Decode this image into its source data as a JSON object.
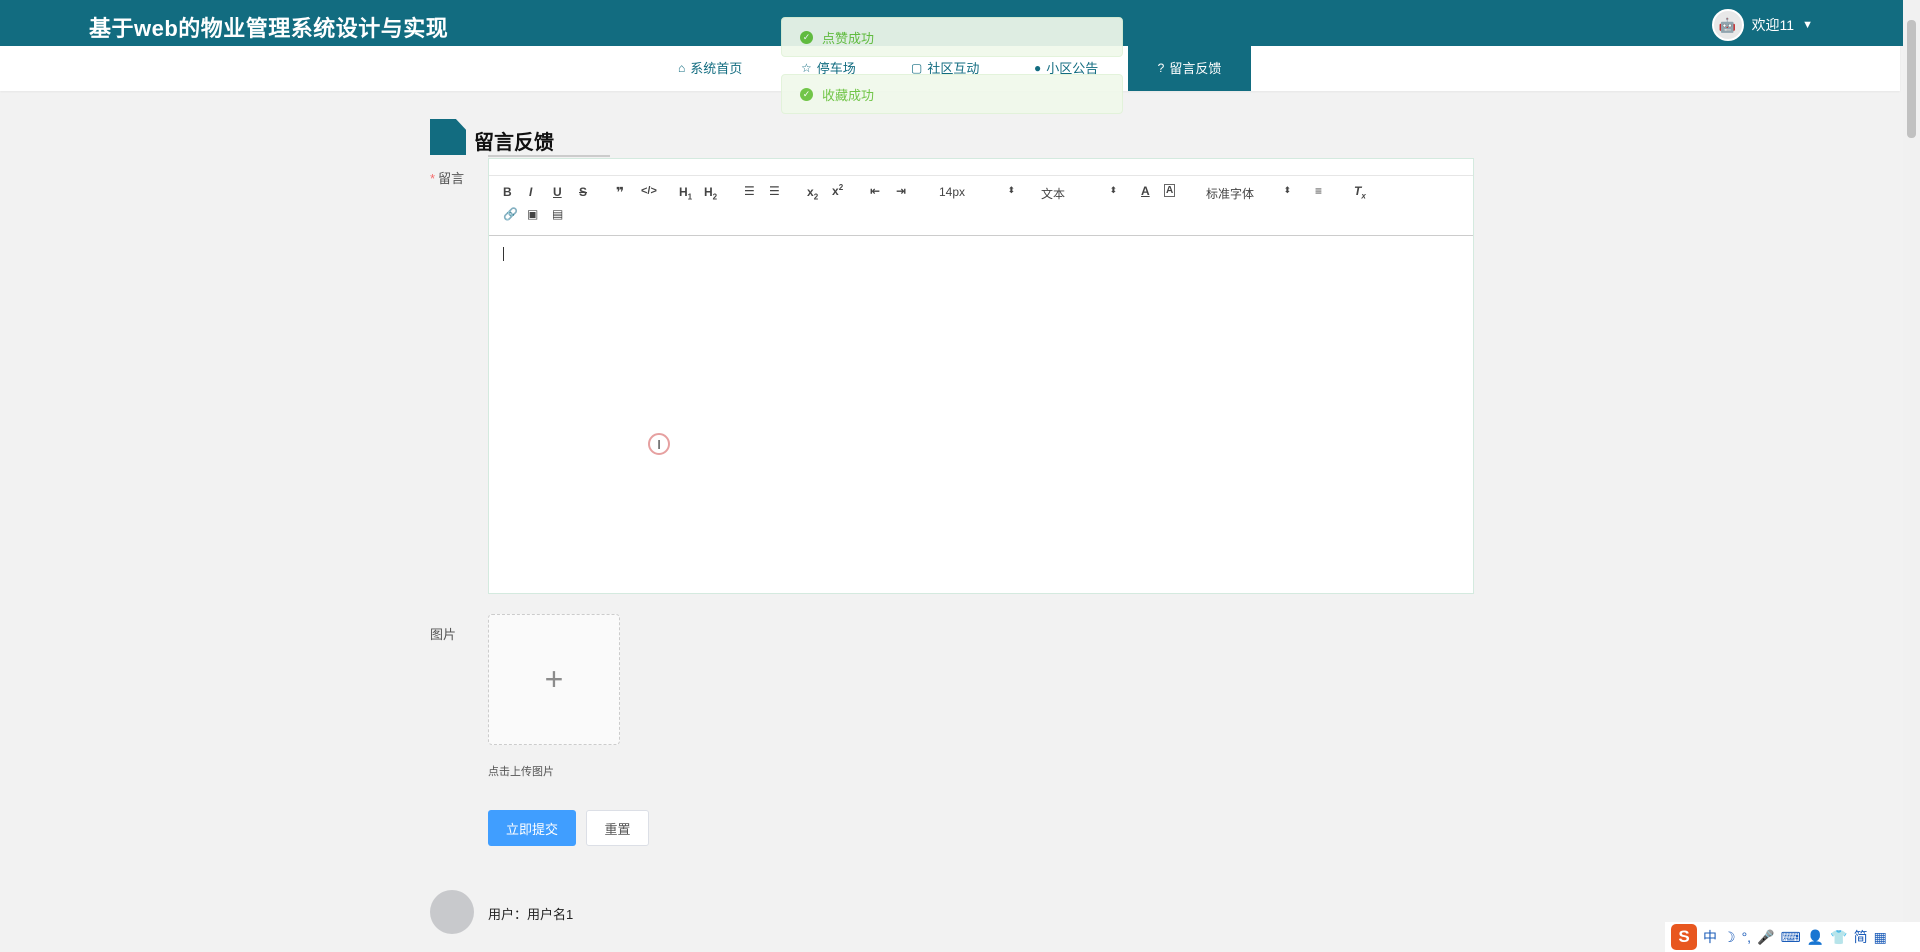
{
  "header": {
    "title": "基于web的物业管理系统设计与实现",
    "welcome": "欢迎11",
    "avatar_icon": "robot-avatar-icon"
  },
  "nav": {
    "items": [
      {
        "label": "系统首页",
        "icon": "home-icon"
      },
      {
        "label": "停车场",
        "icon": "star-icon"
      },
      {
        "label": "社区互动",
        "icon": "bag-icon"
      },
      {
        "label": "小区公告",
        "icon": "info-icon"
      },
      {
        "label": "留言反馈",
        "icon": "question-icon",
        "active": true
      }
    ]
  },
  "toasts": [
    "点赞成功",
    "收藏成功"
  ],
  "section": {
    "title": "留言反馈"
  },
  "form": {
    "message_label": "留言",
    "image_label": "图片",
    "upload_tip": "点击上传图片",
    "submit_label": "立即提交",
    "reset_label": "重置"
  },
  "editor": {
    "font_size": "14px",
    "header_select": "文本",
    "font_family": "标准字体",
    "content": ""
  },
  "comment": {
    "user": "用户：用户名1"
  },
  "ime": {
    "lang": "中",
    "mode": "简"
  },
  "colors": {
    "primary": "#126c80",
    "button": "#409eff",
    "success": "#67c23a"
  }
}
